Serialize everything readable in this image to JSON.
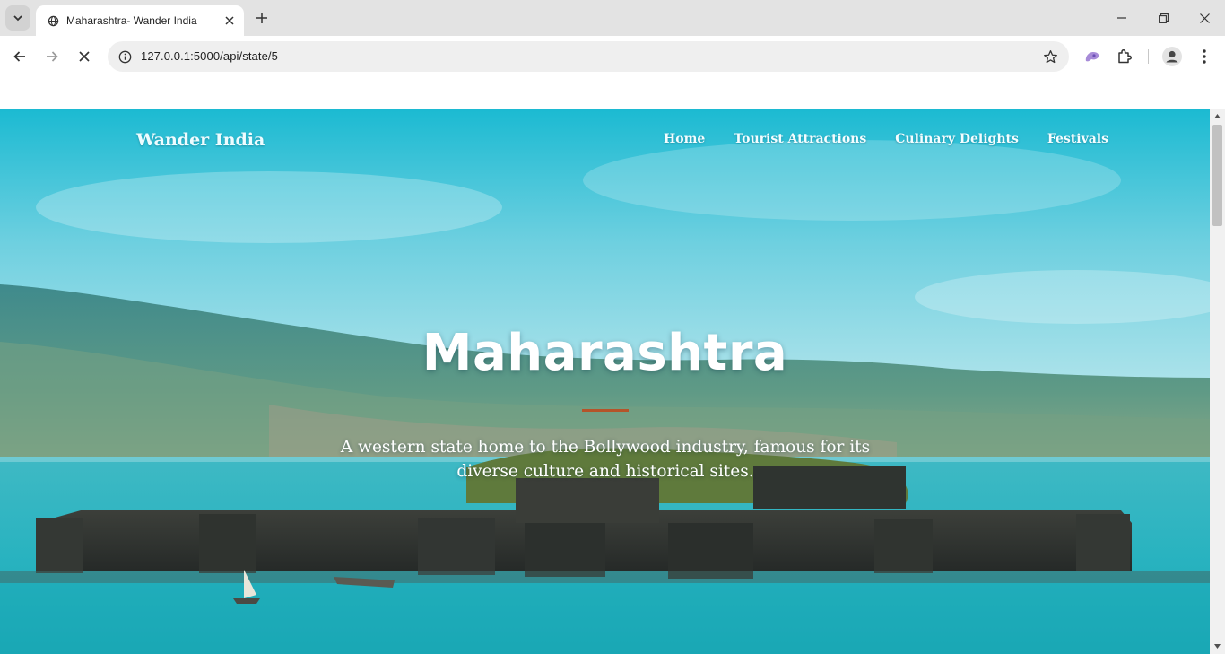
{
  "browser": {
    "tab_title": "Maharashtra- Wander India",
    "url": "127.0.0.1:5000/api/state/5"
  },
  "site": {
    "brand": "Wander India",
    "nav": [
      "Home",
      "Tourist Attractions",
      "Culinary Delights",
      "Festivals"
    ]
  },
  "hero": {
    "title": "Maharashtra",
    "subtitle": "A western state home to the Bollywood industry, famous for its diverse culture and historical sites.",
    "accent_color": "#b4542a"
  },
  "icons": {
    "tab_search": "chevron-down-icon",
    "favicon": "globe-icon",
    "tab_close": "close-icon",
    "new_tab": "plus-icon",
    "minimize": "minimize-icon",
    "restore": "restore-icon",
    "close_window": "close-icon",
    "back": "arrow-left-icon",
    "forward": "arrow-right-icon",
    "stop": "stop-loading-icon",
    "site_info": "info-icon",
    "bookmark": "star-icon",
    "extension_ai": "gemini-icon",
    "extensions": "puzzle-icon",
    "profile": "avatar-icon",
    "menu": "more-vertical-icon"
  }
}
